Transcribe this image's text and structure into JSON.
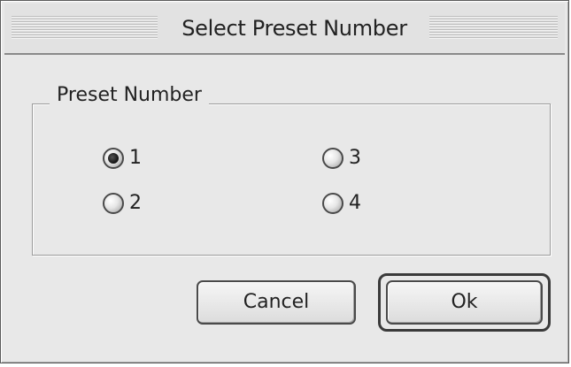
{
  "dialog": {
    "title": "Select Preset Number"
  },
  "preset_group": {
    "label": "Preset Number",
    "options": [
      {
        "label": "1",
        "selected": true
      },
      {
        "label": "2",
        "selected": false
      },
      {
        "label": "3",
        "selected": false
      },
      {
        "label": "4",
        "selected": false
      }
    ],
    "selected_value": "1"
  },
  "buttons": {
    "cancel_label": "Cancel",
    "ok_label": "Ok"
  }
}
